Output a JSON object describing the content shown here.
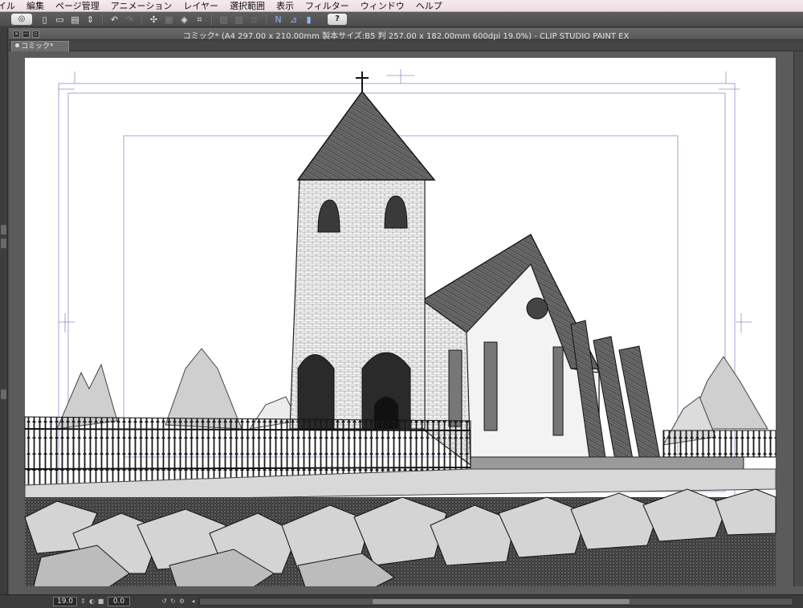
{
  "menubar": {
    "items": [
      "イル",
      "編集",
      "ページ管理",
      "アニメーション",
      "レイヤー",
      "選択範囲",
      "表示",
      "フィルター",
      "ウィンドウ",
      "ヘルプ"
    ]
  },
  "toolbar": {
    "icons": [
      "clip-studio-logo-icon",
      "new-file-icon",
      "open-file-icon",
      "save-icon",
      "undo-icon",
      "redo-icon",
      "transform-icon",
      "fill-icon",
      "help-icon"
    ],
    "help_label": "?"
  },
  "window": {
    "title": "コミック* (A4 297.00 x 210.00mm 製本サイズ:B5 判 257.00 x 182.00mm 600dpi 19.0%)  - CLIP STUDIO PAINT EX",
    "tab_label": "コミック*"
  },
  "status": {
    "zoom": "19.0",
    "angle": "0.0"
  },
  "colors": {
    "guide": "#8e8ecb",
    "canvas": "#ffffff",
    "workspace": "#5b5b5b"
  }
}
